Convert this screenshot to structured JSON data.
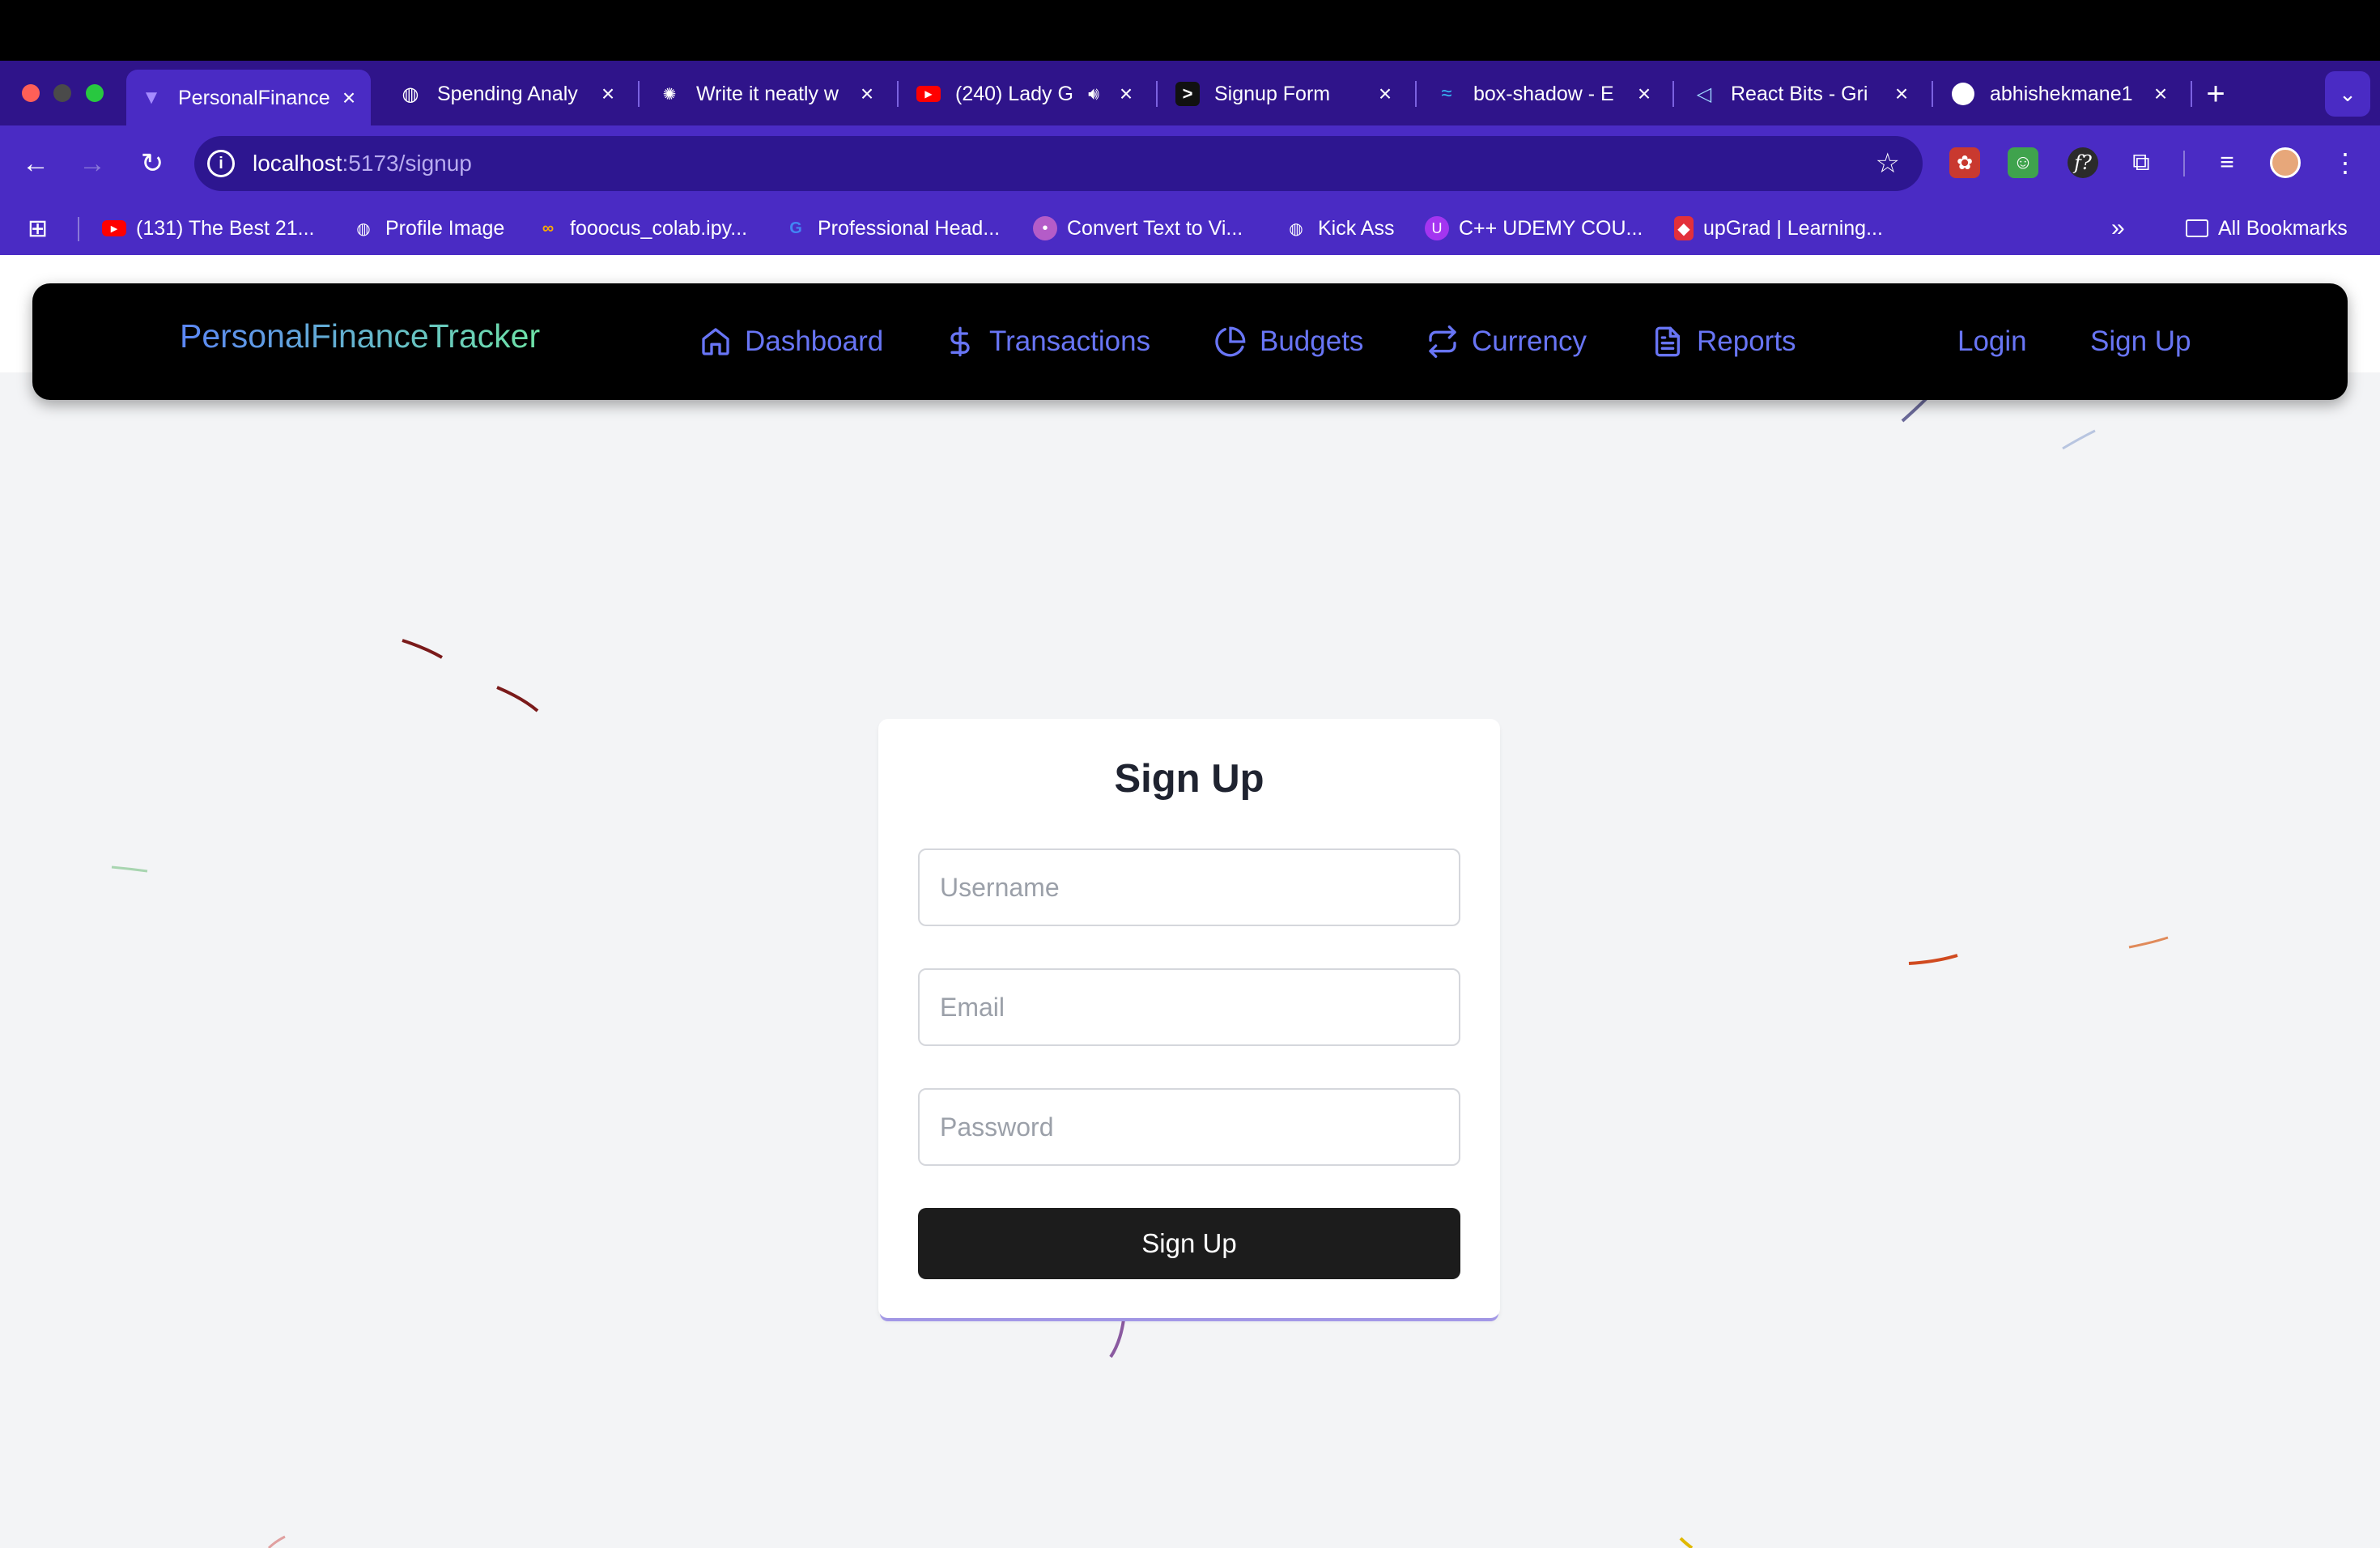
{
  "browser": {
    "tabs": [
      {
        "title": "PersonalFinance",
        "favicon": "vite-icon",
        "active": true
      },
      {
        "title": "Spending Analy",
        "favicon": "globe-icon"
      },
      {
        "title": "Write it neatly w",
        "favicon": "openai-icon"
      },
      {
        "title": "(240) Lady G",
        "favicon": "youtube-icon",
        "audio": true
      },
      {
        "title": "Signup Form",
        "favicon": "terminal-icon"
      },
      {
        "title": "box-shadow - E",
        "favicon": "tailwind-icon"
      },
      {
        "title": "React Bits - Gri",
        "favicon": "reactbits-icon"
      },
      {
        "title": "abhishekmane1",
        "favicon": "github-icon"
      }
    ],
    "new_tab_symbol": "+",
    "address": {
      "host": "localhost",
      "path": ":5173/signup"
    },
    "bookmarks": [
      {
        "label": "(131) The Best 21...",
        "icon": "youtube-icon"
      },
      {
        "label": "Profile Image",
        "icon": "globe-icon"
      },
      {
        "label": "fooocus_colab.ipy...",
        "icon": "colab-icon"
      },
      {
        "label": "Professional Head...",
        "icon": "google-icon"
      },
      {
        "label": "Convert Text to Vi...",
        "icon": "ai-icon"
      },
      {
        "label": "Kick Ass",
        "icon": "globe-icon"
      },
      {
        "label": "C++ UDEMY COU...",
        "icon": "udemy-icon"
      },
      {
        "label": "upGrad | Learning...",
        "icon": "upgrad-icon"
      }
    ],
    "more_bookmarks": "»",
    "all_bookmarks": "All Bookmarks"
  },
  "app": {
    "brand": "PersonalFinanceTracker",
    "nav": [
      {
        "label": "Dashboard",
        "icon": "home-icon"
      },
      {
        "label": "Transactions",
        "icon": "dollar-icon"
      },
      {
        "label": "Budgets",
        "icon": "pie-chart-icon"
      },
      {
        "label": "Currency",
        "icon": "exchange-icon"
      },
      {
        "label": "Reports",
        "icon": "file-text-icon"
      }
    ],
    "login": "Login",
    "signup": "Sign Up"
  },
  "form": {
    "title": "Sign Up",
    "username_placeholder": "Username",
    "email_placeholder": "Email",
    "password_placeholder": "Password",
    "submit": "Sign Up"
  },
  "colors": {
    "chrome": "#4a2bc4",
    "nav_link": "#6875f5",
    "button": "#1c1c1c"
  }
}
